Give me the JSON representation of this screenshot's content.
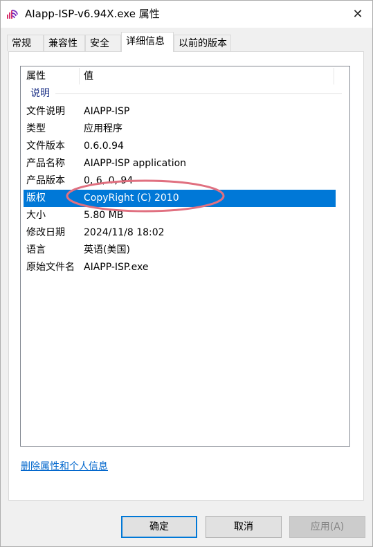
{
  "window": {
    "title": "AIapp-ISP-v6.94X.exe 属性",
    "close_glyph": "✕"
  },
  "tabs": [
    {
      "label": "常规",
      "active": false
    },
    {
      "label": "兼容性",
      "active": false
    },
    {
      "label": "安全",
      "active": false
    },
    {
      "label": "详细信息",
      "active": true
    },
    {
      "label": "以前的版本",
      "active": false
    }
  ],
  "list": {
    "header": {
      "property": "属性",
      "value": "值"
    },
    "group_label": "说明",
    "rows": [
      {
        "key": "文件说明",
        "value": "AIAPP-ISP"
      },
      {
        "key": "类型",
        "value": "应用程序"
      },
      {
        "key": "文件版本",
        "value": "0.6.0.94"
      },
      {
        "key": "产品名称",
        "value": "AIAPP-ISP application"
      },
      {
        "key": "产品版本",
        "value": "0, 6, 0, 94"
      },
      {
        "key": "版权",
        "value": "CopyRight (C) 2010"
      },
      {
        "key": "大小",
        "value": "5.80 MB"
      },
      {
        "key": "修改日期",
        "value": "2024/11/8 18:02"
      },
      {
        "key": "语言",
        "value": "英语(美国)"
      },
      {
        "key": "原始文件名",
        "value": "AIAPP-ISP.exe"
      }
    ],
    "selected_index": 5
  },
  "remove_link": "删除属性和个人信息",
  "buttons": {
    "ok": "确定",
    "cancel": "取消",
    "apply": "应用(A)"
  },
  "colors": {
    "selection": "#0078d7",
    "annotation": "#e07080",
    "link": "#0066cc"
  }
}
